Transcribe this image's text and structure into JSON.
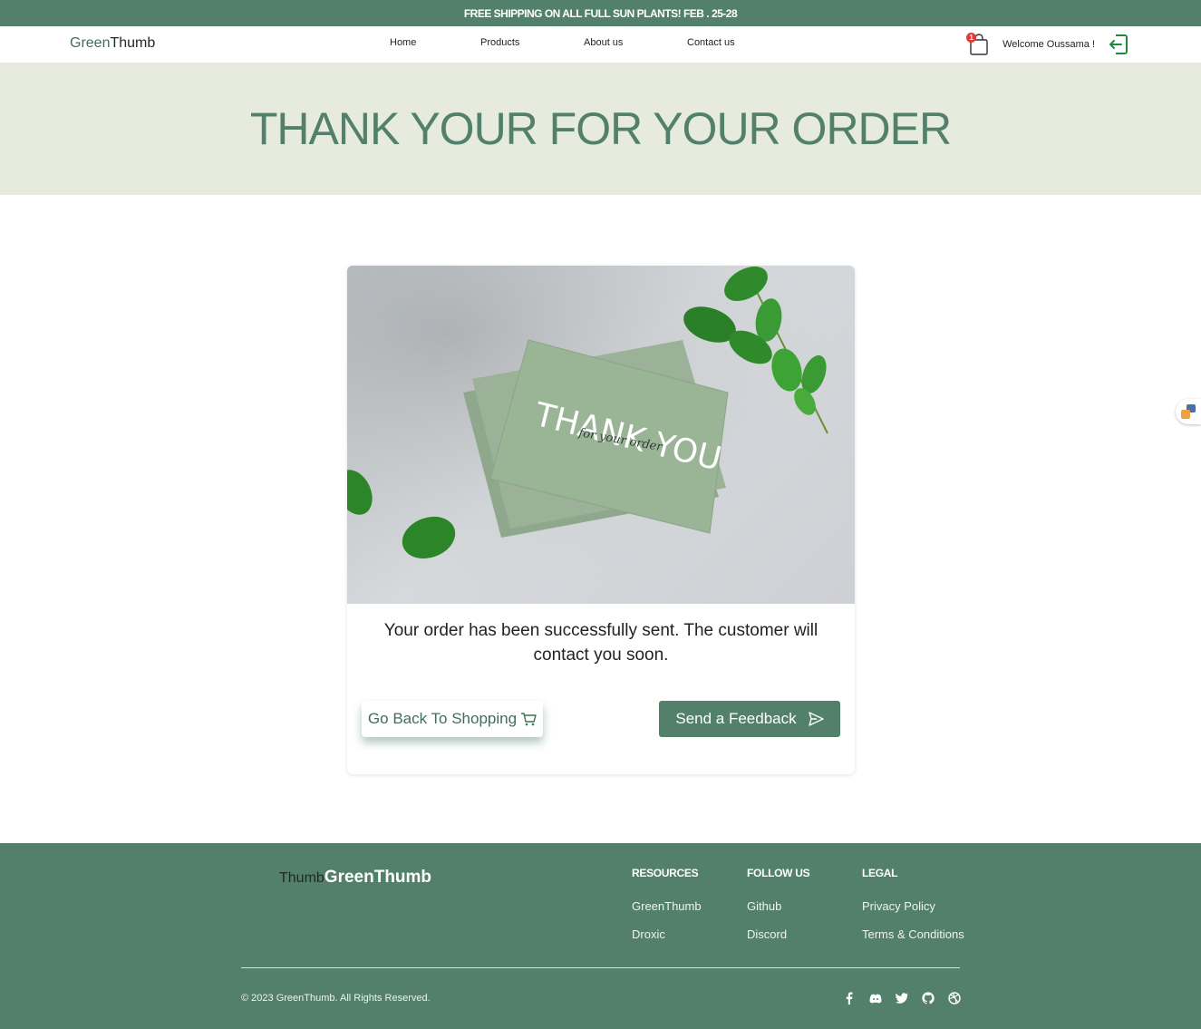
{
  "promo": {
    "text": "FREE SHIPPING ON ALL FULL SUN PLANTS! FEB . 25-28"
  },
  "header": {
    "logo_part1": "Green",
    "logo_part2": "Thumb",
    "nav": [
      "Home",
      "Products",
      "About us",
      "Contact us"
    ],
    "cart_count": "1",
    "welcome": "Welcome Oussama !"
  },
  "hero": {
    "title": "THANK YOUR FOR YOUR ORDER"
  },
  "card": {
    "image_text_main": "THANK YOU",
    "image_text_script": "for your order",
    "message": "Your order has been successfully sent. The customer will contact you soon.",
    "back_label": "Go Back To Shopping",
    "feedback_label": "Send a Feedback"
  },
  "footer": {
    "logo_prefix": "Thumb",
    "logo": "GreenThumb",
    "columns": [
      {
        "title": "RESOURCES",
        "links": [
          "GreenThumb",
          "Droxic"
        ]
      },
      {
        "title": "FOLLOW US",
        "links": [
          "Github",
          "Discord"
        ]
      },
      {
        "title": "LEGAL",
        "links": [
          "Privacy Policy",
          "Terms & Conditions"
        ]
      }
    ],
    "copyright": "© 2023 GreenThumb. All Rights Reserved.",
    "socials": [
      "facebook-icon",
      "discord-icon",
      "twitter-icon",
      "github-icon",
      "dribbble-icon"
    ]
  },
  "colors": {
    "primary": "#52806b",
    "hero_bg": "#e6ebde",
    "badge": "#e53935"
  }
}
